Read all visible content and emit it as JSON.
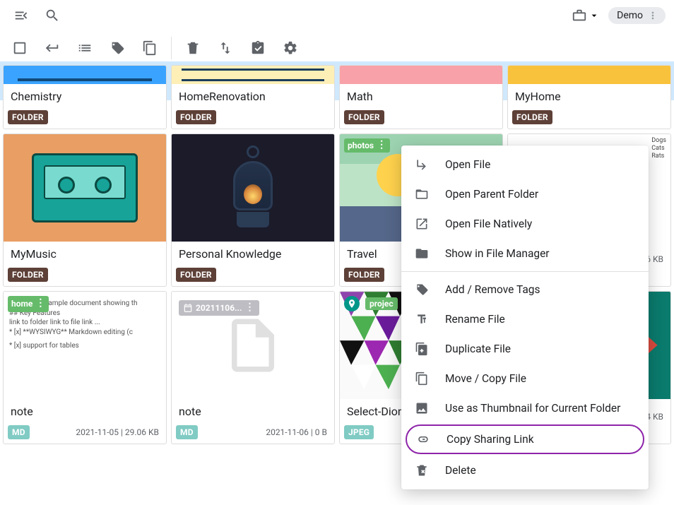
{
  "topbar": {
    "cart_badge": "",
    "user_label": "Demo"
  },
  "folders_row1": [
    {
      "title": "Chemistry",
      "badge": "FOLDER"
    },
    {
      "title": "HomeRenovation",
      "badge": "FOLDER"
    },
    {
      "title": "Math",
      "badge": "FOLDER"
    },
    {
      "title": "MyHome",
      "badge": "FOLDER"
    }
  ],
  "folders_row2": [
    {
      "title": "MyMusic",
      "badge": "FOLDER"
    },
    {
      "title": "Personal Knowledge",
      "badge": "FOLDER"
    },
    {
      "title": "Travel",
      "badge": "FOLDER",
      "tag": "photos"
    }
  ],
  "obscured_card": {
    "legend": "Dogs\nCats\nRats",
    "meta_right": "6 KB"
  },
  "files_row3": [
    {
      "title": "note",
      "badge": "MD",
      "meta": "2021-11-05 | 29.06 KB",
      "tag": "home",
      "preview_lines": [
        "This is an example document showing th",
        "## Key Features",
        "link to folder link to file link ...",
        "*  [x] **WYSIWYG** Markdown editing (c",
        "*  [x] support for tables"
      ]
    },
    {
      "title": "note",
      "badge": "MD",
      "meta": "2021-11-06 | 0 B",
      "date_tag": "20211106..."
    },
    {
      "title": "Select-Dion",
      "badge": "JPEG",
      "tag": "projec"
    }
  ],
  "obscured_card2": {
    "meta_right": "4 KB"
  },
  "context_menu": {
    "open_file": "Open File",
    "open_parent": "Open Parent Folder",
    "open_natively": "Open File Natively",
    "show_in_fm": "Show in File Manager",
    "tags": "Add / Remove Tags",
    "rename": "Rename File",
    "duplicate": "Duplicate File",
    "movecopy": "Move / Copy File",
    "thumb": "Use as Thumbnail for Current Folder",
    "share": "Copy Sharing Link",
    "delete": "Delete"
  }
}
